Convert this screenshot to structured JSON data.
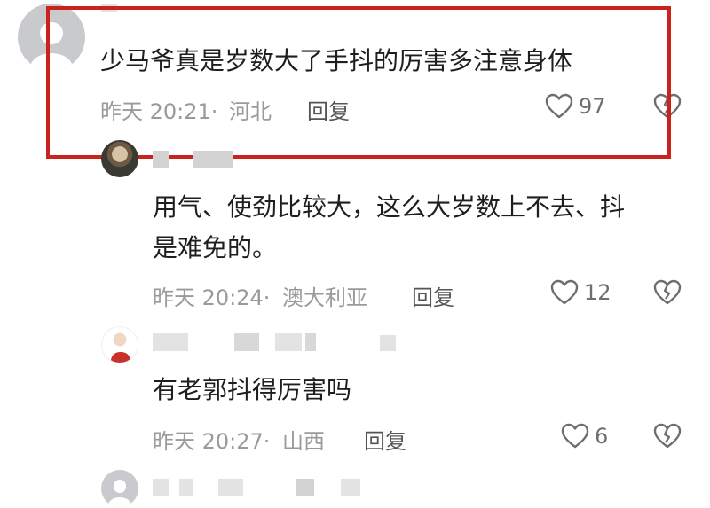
{
  "comments": [
    {
      "text": "少马爷真是岁数大了手抖的厉害多注意身体",
      "time": "昨天 20:21·",
      "location": "河北",
      "reply_label": "回复",
      "like_count": "97"
    },
    {
      "text_line1": "用气、使劲比较大，这么大岁数上不去、抖",
      "text_line2": "是难免的。",
      "time": "昨天 20:24·",
      "location": "澳大利亚",
      "reply_label": "回复",
      "like_count": "12"
    },
    {
      "text": "有老郭抖得厉害吗",
      "time": "昨天 20:27·",
      "location": "山西",
      "reply_label": "回复",
      "like_count": "6"
    }
  ],
  "colors": {
    "highlight_border": "#c8231c",
    "meta_text": "#9a9a9a",
    "body_text": "#1e1e1e"
  }
}
